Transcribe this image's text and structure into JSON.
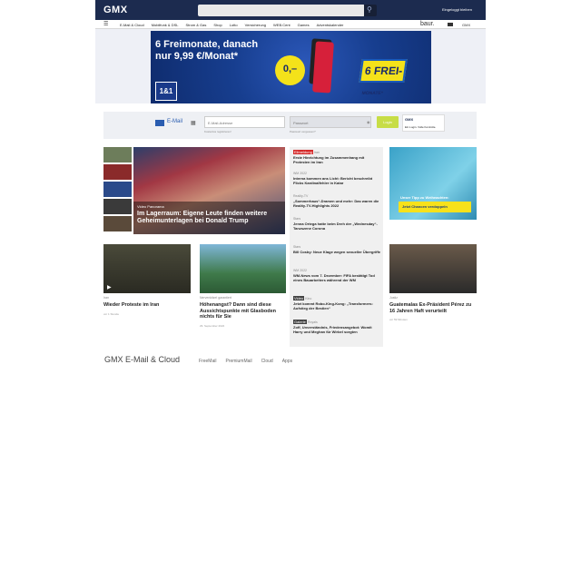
{
  "header": {
    "logo": "GMX",
    "login_label": "Eingeloggt bleiben",
    "search_icon": "search-icon"
  },
  "nav": {
    "menu_icon": "☰",
    "items": [
      "E-Mail & Cloud",
      "Mobilfunk & DSL",
      "Strom & Gas",
      "Shop",
      "Lotto",
      "Versicherung",
      "WEB.Cent",
      "Games",
      "Adventskalender"
    ],
    "brand": "baur.",
    "right": "GMX"
  },
  "ad": {
    "headline_1": "6 Freimonate, danach",
    "headline_2": "nur 9,99 €/Monat*",
    "logo": "1&1",
    "price": "0,–",
    "badge": "6 FREI-",
    "badge_sub": "MONATE*"
  },
  "mail": {
    "label": "E-Mail",
    "email_placeholder": "E-Mail-Adresse",
    "password_placeholder": "Passwort",
    "register_link": "Kostenlos registrieren!",
    "forgot_link": "Passwort vergessen?",
    "login_button": "Login",
    "badge": "GMX",
    "badge_sub": "Ein Login. Volle Kontrolle."
  },
  "main_story": {
    "kicker": "Video  Panorama",
    "title": "Im Lagerraum: Eigene Leute finden weitere Geheimunterlagen bei Donald Trump"
  },
  "middle_list": [
    {
      "label": "Eilmeldung",
      "kicker": "Iran",
      "title": "Erste Hinrichtung im Zusammenhang mit Protesten im Iran"
    },
    {
      "label": "",
      "kicker": "WM 2022",
      "title": "Interna kommen ans Licht: Bericht beschreibt Flicks Kardinalfehler in Katar"
    },
    {
      "label": "",
      "kicker": "Reality-TV",
      "title": "„Sommerhaus“-Dramen und mehr: Das waren die Reality-TV-Highlights 2022"
    },
    {
      "label": "",
      "kicker": "Stars",
      "title": "Jenna Ortega hatte beim Dreh der „Wednesday“-Tanzszene Corona"
    },
    {
      "label": "",
      "kicker": "Stars",
      "title": "Bill Cosby: Neue Klage wegen sexueller Übergriffe"
    },
    {
      "label": "",
      "kicker": "WM 2022",
      "title": "WM-News vom 7. Dezember: FIFA bestätigt Tod eines Bauarbeiters während der WM"
    },
    {
      "label": "Video",
      "kicker": "Kino",
      "title": "Jetzt kommt Robo-King-Kong: „Transformers: Aufstieg der Bestien“"
    },
    {
      "label": "Galerie",
      "kicker": "Royals",
      "title": "Zoff, Unverständnis, Friedensangebot: Womit Harry und Meghan für Wirbel sorgten"
    }
  ],
  "right_ad": {
    "title": "Unser Tipp zu Weihnachten:",
    "button": "Jetzt Chancen verdoppeln"
  },
  "cards": [
    {
      "kicker": "Iran",
      "title": "Wieder Proteste im Iran",
      "meta": "vor 1 Stunde"
    },
    {
      "kicker": "Nervenkitzel garantiert",
      "title": "Höhenangst? Dann sind diese Aussichtspunkte mit Glasboden nichts für Sie",
      "meta": "29. September 2022"
    },
    {
      "kicker": "Justiz",
      "title": "Guatemalas Ex-Präsident Pérez zu 16 Jahren Haft verurteilt",
      "meta": "vor 59 Minuten"
    }
  ],
  "footer": {
    "title": "GMX E-Mail & Cloud",
    "links": [
      "FreeMail",
      "PremiumMail",
      "Cloud",
      "Apps"
    ]
  }
}
